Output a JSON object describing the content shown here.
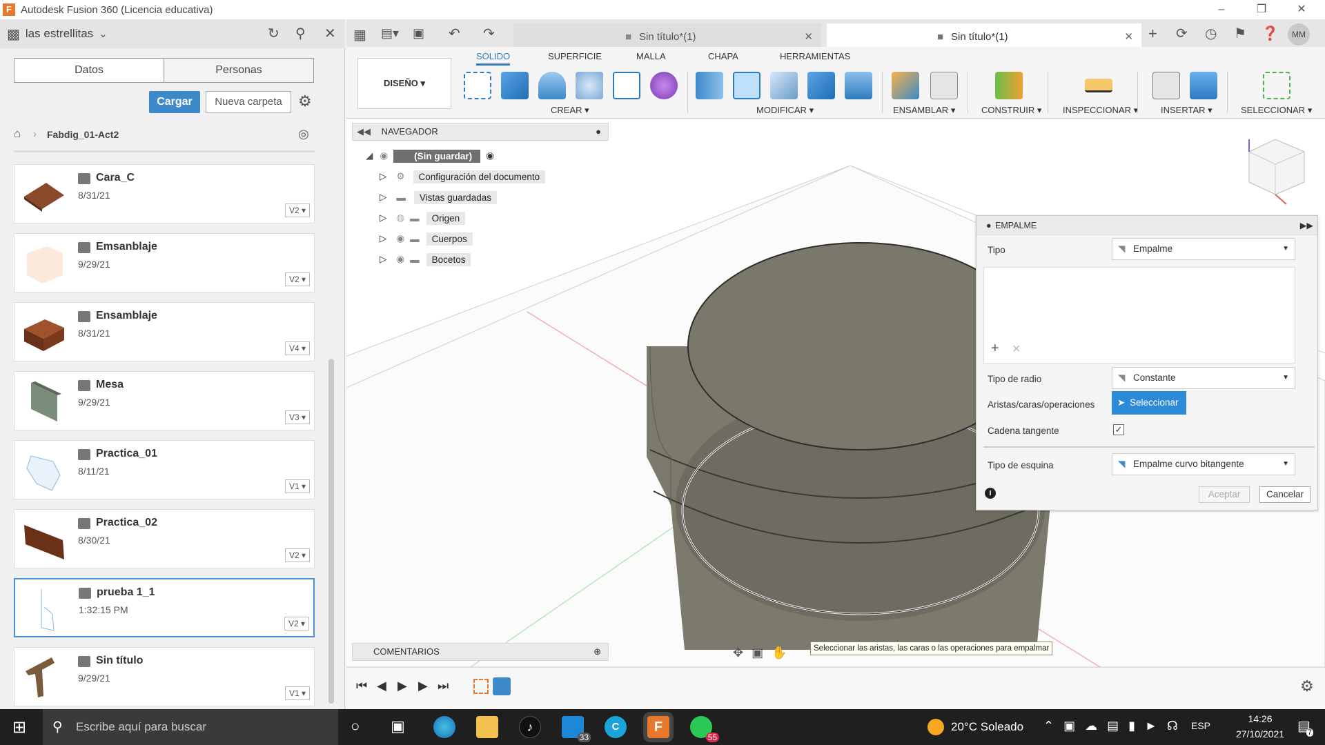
{
  "window": {
    "title": "Autodesk Fusion 360 (Licencia educativa)"
  },
  "left_panel": {
    "team": "las estrellitas",
    "tabs": [
      "Datos",
      "Personas"
    ],
    "upload_label": "Cargar",
    "new_folder_label": "Nueva carpeta",
    "breadcrumb": "Fabdig_01-Act2",
    "files": [
      {
        "name": "Cara_C",
        "date": "8/31/21",
        "version": "V2"
      },
      {
        "name": "Emsanblaje",
        "date": "9/29/21",
        "version": "V2"
      },
      {
        "name": "Ensamblaje",
        "date": "8/31/21",
        "version": "V4"
      },
      {
        "name": "Mesa",
        "date": "9/29/21",
        "version": "V3"
      },
      {
        "name": "Practica_01",
        "date": "8/11/21",
        "version": "V1"
      },
      {
        "name": "Practica_02",
        "date": "8/30/21",
        "version": "V2"
      },
      {
        "name": "prueba 1_1",
        "date": "1:32:15 PM",
        "version": "V2"
      },
      {
        "name": "Sin título",
        "date": "9/29/21",
        "version": "V1"
      }
    ]
  },
  "doc_tabs": [
    "Sin título*(1)",
    "Sin título*(1)"
  ],
  "user_initials": "MM",
  "toolbar": {
    "workspace": "DISEÑO",
    "tabs": [
      "SOLIDO",
      "SUPERFICIE",
      "MALLA",
      "CHAPA",
      "HERRAMIENTAS"
    ],
    "groups": [
      "CREAR",
      "MODIFICAR",
      "ENSAMBLAR",
      "CONSTRUIR",
      "INSPECCIONAR",
      "INSERTAR",
      "SELECCIONAR"
    ]
  },
  "navigator": {
    "title": "NAVEGADOR",
    "root": "(Sin guardar)",
    "items": [
      "Configuración del documento",
      "Vistas guardadas",
      "Origen",
      "Cuerpos",
      "Bocetos"
    ]
  },
  "comments": {
    "title": "COMENTARIOS"
  },
  "tooltip": "Seleccionar las aristas, las caras o las operaciones para empalmar",
  "dialog": {
    "title": "EMPALME",
    "tipo_label": "Tipo",
    "tipo_value": "Empalme",
    "radio_label": "Tipo de radio",
    "radio_value": "Constante",
    "aristas_label": "Aristas/caras/operaciones",
    "select_label": "Seleccionar",
    "cadena_label": "Cadena tangente",
    "esquina_label": "Tipo de esquina",
    "esquina_value": "Empalme curvo bitangente",
    "ok_label": "Aceptar",
    "cancel_label": "Cancelar"
  },
  "taskbar": {
    "search_placeholder": "Escribe aquí para buscar",
    "weather": "20°C  Soleado",
    "lang": "ESP",
    "time": "14:26",
    "date": "27/10/2021",
    "badge_33": "33",
    "badge_55": "55",
    "notif": "7"
  }
}
